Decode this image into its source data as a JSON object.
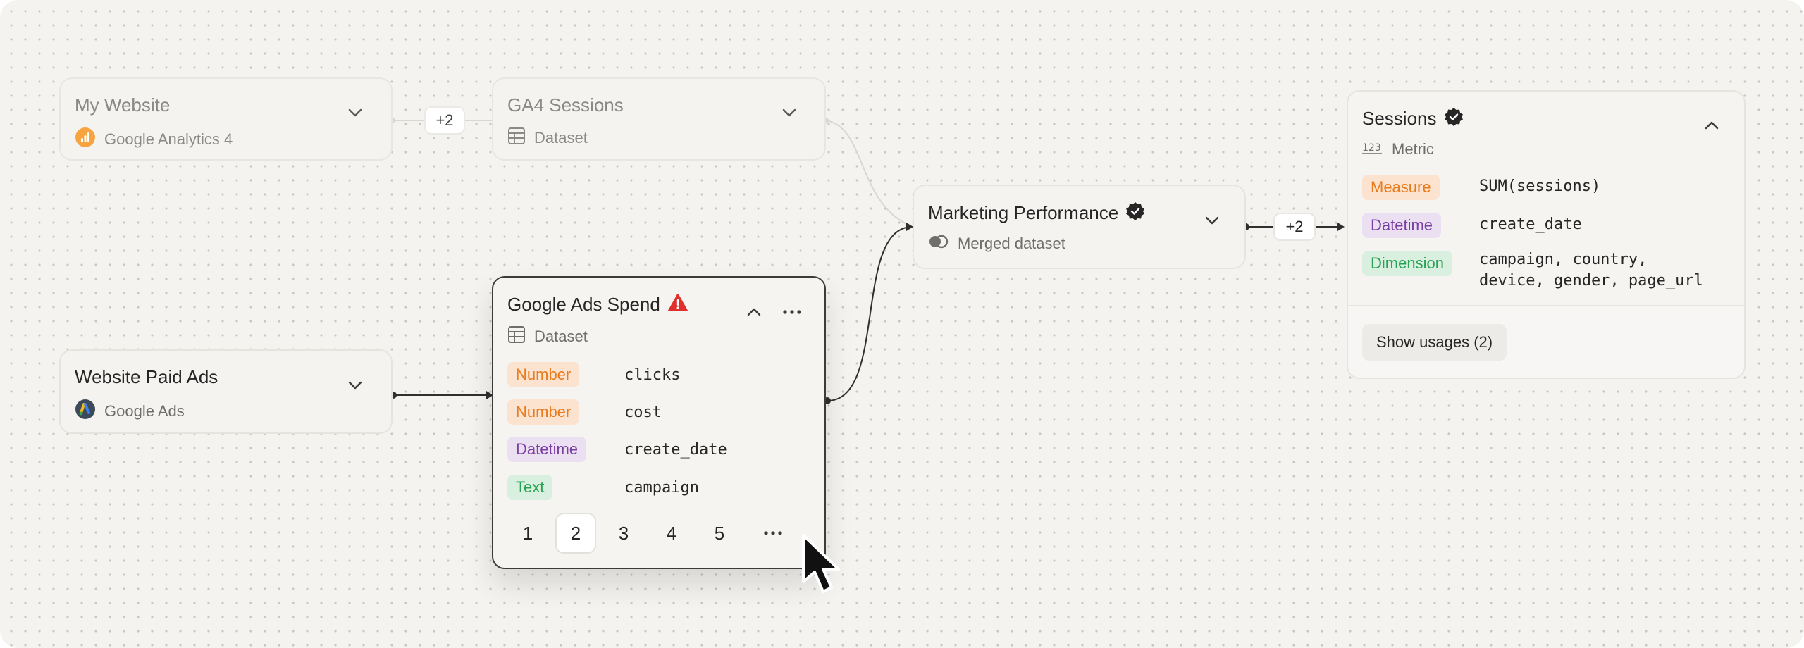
{
  "nodes": {
    "my_website": {
      "title": "My Website",
      "subtitle": "Google Analytics 4",
      "icon": "google-analytics-icon"
    },
    "ga4_sessions": {
      "title": "GA4 Sessions",
      "subtitle": "Dataset",
      "icon": "table-icon"
    },
    "marketing_performance": {
      "title": "Marketing Performance",
      "subtitle": "Merged dataset",
      "icon": "merged-dataset-icon",
      "verified": true
    },
    "website_paid_ads": {
      "title": "Website Paid Ads",
      "subtitle": "Google Ads",
      "icon": "google-ads-icon"
    },
    "google_ads_spend": {
      "title": "Google Ads Spend",
      "subtitle": "Dataset",
      "icon": "table-icon",
      "warning": true,
      "fields": [
        {
          "type": "Number",
          "name": "clicks"
        },
        {
          "type": "Number",
          "name": "cost"
        },
        {
          "type": "Datetime",
          "name": "create_date"
        },
        {
          "type": "Text",
          "name": "campaign"
        }
      ],
      "pages": [
        "1",
        "2",
        "3",
        "4",
        "5"
      ],
      "active_page": "2"
    },
    "sessions": {
      "title": "Sessions",
      "subtitle": "Metric",
      "icon": "123-icon",
      "verified": true,
      "rows": [
        {
          "label": "Measure",
          "value": "SUM(sessions)"
        },
        {
          "label": "Datetime",
          "value": "create_date"
        },
        {
          "label": "Dimension",
          "value_line1": "campaign, country,",
          "value_line2": "device, gender, page_url"
        }
      ],
      "usage_button": "Show usages (2)"
    }
  },
  "chips": {
    "top_collapsed": "+2",
    "right_collapsed": "+2"
  },
  "colors": {
    "canvas": "#f4f3f0",
    "number_tag": "#ea7a1a",
    "datetime_tag": "#7a3fa3",
    "text_tag": "#29a353",
    "warning": "#e0302b",
    "verified": "#262626"
  }
}
